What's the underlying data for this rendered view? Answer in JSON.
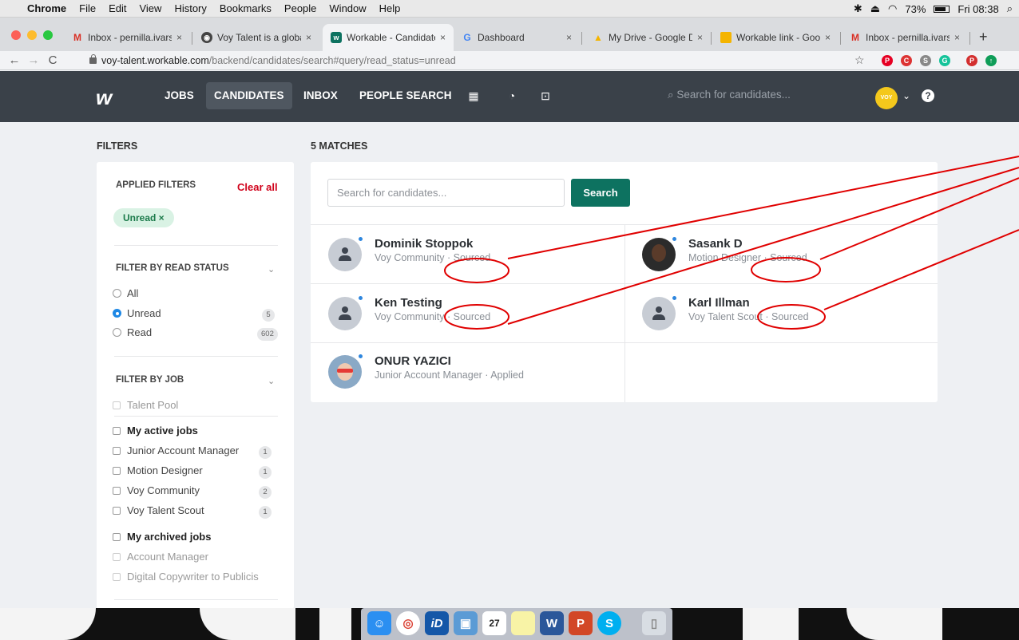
{
  "menubar": {
    "app": "Chrome",
    "items": [
      "File",
      "Edit",
      "View",
      "History",
      "Bookmarks",
      "People",
      "Window",
      "Help"
    ],
    "battery": "73%",
    "clock": "Fri 08:38"
  },
  "tabs": [
    {
      "label": "Inbox - pernilla.ivarss",
      "icon": "gmail-icon"
    },
    {
      "label": "Voy Talent is a global",
      "icon": "globe-icon"
    },
    {
      "label": "Workable - Candidate",
      "icon": "workable-icon"
    },
    {
      "label": "Dashboard",
      "icon": "google-icon"
    },
    {
      "label": "My Drive - Google Dri",
      "icon": "drive-icon"
    },
    {
      "label": "Workable link - Googl",
      "icon": "slides-icon"
    },
    {
      "label": "Inbox - pernilla.ivarss",
      "icon": "gmail-icon"
    }
  ],
  "address": {
    "host": "voy-talent.workable.com",
    "path": "/backend/candidates/search#query/read_status=unread"
  },
  "nav": {
    "items": [
      "JOBS",
      "CANDIDATES",
      "INBOX",
      "PEOPLE SEARCH"
    ],
    "active": "CANDIDATES",
    "search_placeholder": "Search for candidates...",
    "avatar_text": "VOY"
  },
  "filters": {
    "heading": "FILTERS",
    "applied_title": "APPLIED FILTERS",
    "clear_all": "Clear all",
    "chip": "Unread ×",
    "read_status_title": "FILTER BY READ STATUS",
    "read_status": [
      {
        "label": "All",
        "selected": false,
        "count": ""
      },
      {
        "label": "Unread",
        "selected": true,
        "count": "5"
      },
      {
        "label": "Read",
        "selected": false,
        "count": "602"
      }
    ],
    "job_title": "FILTER BY JOB",
    "talent_pool": "Talent Pool",
    "active_jobs_title": "My active jobs",
    "active_jobs": [
      {
        "label": "Junior Account Manager",
        "count": "1"
      },
      {
        "label": "Motion Designer",
        "count": "1"
      },
      {
        "label": "Voy Community",
        "count": "2"
      },
      {
        "label": "Voy Talent Scout",
        "count": "1"
      }
    ],
    "archived_jobs_title": "My archived jobs",
    "archived_jobs": [
      "Account Manager",
      "Digital Copywriter to Publicis"
    ]
  },
  "results": {
    "heading": "5 MATCHES",
    "search_placeholder": "Search for candidates...",
    "search_button": "Search",
    "candidates": [
      {
        "name": "Dominik Stoppok",
        "subtitle": "Voy Community · Sourced"
      },
      {
        "name": "Sasank D",
        "subtitle": "Motion Designer · Sourced"
      },
      {
        "name": "Ken Testing",
        "subtitle": "Voy Community · Sourced"
      },
      {
        "name": "Karl Illman",
        "subtitle": "Voy Talent Scout · Sourced"
      },
      {
        "name": "ONUR YAZICI",
        "subtitle": "Junior Account Manager · Applied"
      }
    ]
  },
  "colors": {
    "nav_bg": "#3a4149",
    "accent": "#0d7260",
    "danger": "#d0021b",
    "unread_dot": "#2e86de",
    "annotation": "#e00000"
  }
}
